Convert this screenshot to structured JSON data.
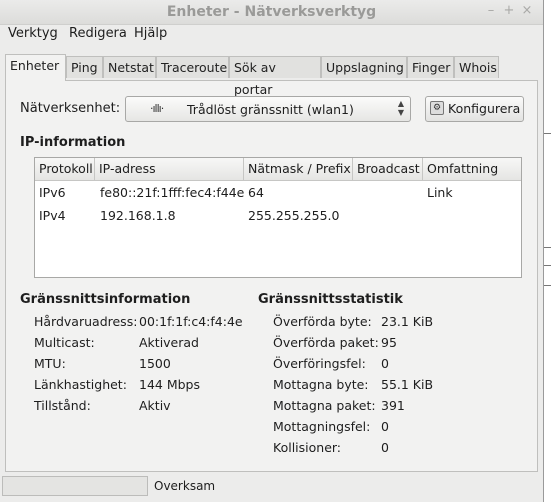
{
  "window": {
    "title": "Enheter - Nätverksverktyg"
  },
  "menubar": [
    {
      "label": "Verktyg"
    },
    {
      "label": "Redigera"
    },
    {
      "label": "Hjälp"
    }
  ],
  "tabs": [
    {
      "label": "Enheter",
      "active": true
    },
    {
      "label": "Ping"
    },
    {
      "label": "Netstat"
    },
    {
      "label": "Traceroute"
    },
    {
      "label": "Sök av portar"
    },
    {
      "label": "Uppslagning"
    },
    {
      "label": "Finger"
    },
    {
      "label": "Whois"
    }
  ],
  "device": {
    "label": "Nätverksenhet:",
    "selected": "Trådlöst gränssnitt (wlan1)",
    "configure_label": "Konfigurera"
  },
  "ip_info": {
    "title": "IP-information",
    "columns": [
      "Protokoll",
      "IP-adress",
      "Nätmask / Prefix",
      "Broadcast",
      "Omfattning"
    ],
    "rows": [
      [
        "IPv6",
        "fe80::21f:1fff:fec4:f44e",
        "64",
        "",
        "Link"
      ],
      [
        "IPv4",
        "192.168.1.8",
        "255.255.255.0",
        "",
        ""
      ]
    ]
  },
  "iface_info": {
    "title": "Gränssnittsinformation",
    "items": [
      {
        "key": "Hårdvaruadress:",
        "value": "00:1f:1f:c4:f4:4e"
      },
      {
        "key": "Multicast:",
        "value": "Aktiverad"
      },
      {
        "key": "MTU:",
        "value": "1500"
      },
      {
        "key": "Länkhastighet:",
        "value": "144 Mbps"
      },
      {
        "key": "Tillstånd:",
        "value": "Aktiv"
      }
    ]
  },
  "iface_stats": {
    "title": "Gränssnittsstatistik",
    "items": [
      {
        "key": "Överförda byte:",
        "value": "23.1 KiB"
      },
      {
        "key": "Överförda paket:",
        "value": "95"
      },
      {
        "key": "Överföringsfel:",
        "value": "0"
      },
      {
        "key": "Mottagna byte:",
        "value": "55.1 KiB"
      },
      {
        "key": "Mottagna paket:",
        "value": "391"
      },
      {
        "key": "Mottagningsfel:",
        "value": "0"
      },
      {
        "key": "Kollisioner:",
        "value": "0"
      }
    ]
  },
  "status": {
    "text": "Overksam"
  }
}
